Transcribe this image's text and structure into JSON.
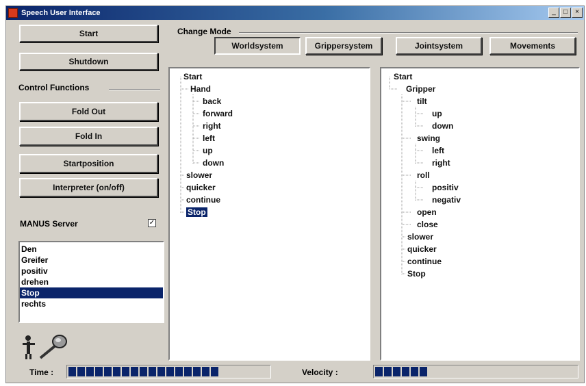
{
  "window": {
    "title": "Speech User Interface",
    "buttons": [
      "_",
      "□",
      "×"
    ]
  },
  "left": {
    "start_label": "Start",
    "shutdown_label": "Shutdown",
    "control_functions_label": "Control Functions",
    "fold_out_label": "Fold Out",
    "fold_in_label": "Fold In",
    "startposition_label": "Startposition",
    "interpreter_label": "Interpreter (on/off)",
    "manus_server_label": "MANUS Server",
    "manus_server_checked": true,
    "log_items": [
      "Den",
      "Greifer",
      "positiv",
      "drehen",
      "Stop",
      "rechts"
    ],
    "selected_log_index": 4,
    "speech_icon": "person-with-microphone-icon"
  },
  "mode": {
    "label": "Change Mode",
    "buttons": [
      "Worldsystem",
      "Grippersystem",
      "Jointsystem",
      "Movements"
    ]
  },
  "tree_left": {
    "root": "Start",
    "hand": "Hand",
    "hand_children": [
      "back",
      "forward",
      "right",
      "left",
      "up",
      "down"
    ],
    "others": [
      "slower",
      "quicker",
      "continue",
      "Stop"
    ],
    "selected": "Stop"
  },
  "tree_right": {
    "root": "Start",
    "gripper": "Gripper",
    "tilt": "tilt",
    "tilt_children": [
      "up",
      "down"
    ],
    "swing": "swing",
    "swing_children": [
      "left",
      "right"
    ],
    "roll": "roll",
    "roll_children": [
      "positiv",
      "negativ"
    ],
    "open": "open",
    "close": "close",
    "others": [
      "slower",
      "quicker",
      "continue",
      "Stop"
    ]
  },
  "status": {
    "time_label": "Time :",
    "time_progress": 0.74,
    "velocity_label": "Velocity :",
    "velocity_progress": 0.27
  },
  "colors": {
    "selection": "#0a246a",
    "face": "#d4d0c8"
  }
}
